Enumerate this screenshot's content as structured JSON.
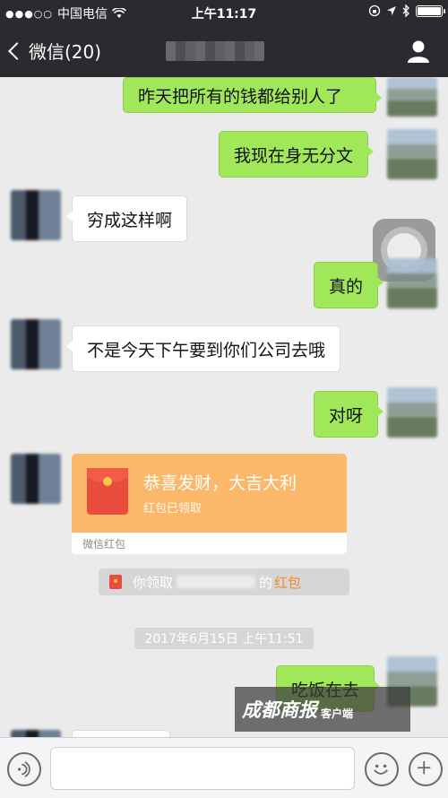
{
  "status_bar": {
    "signal": "●●●○○",
    "carrier": "中国电信",
    "time": "上午11:17"
  },
  "nav": {
    "back_label": "微信(20)"
  },
  "messages": {
    "m1": "昨天把所有的钱都给别人了",
    "m2": "我现在身无分文",
    "m3": "穷成这样啊",
    "m4": "真的",
    "m5": "不是今天下午要到你们公司去哦",
    "m6": "对呀",
    "m7": "吃饭在去"
  },
  "red_packet": {
    "title": "恭喜发财，大吉大利",
    "status": "红包已领取",
    "footer": "微信红包"
  },
  "system_notice": {
    "prefix": "你领取",
    "suffix": "的",
    "link": "红包"
  },
  "timestamp": "2017年6月15日 上午11:51",
  "watermark": {
    "main": "成都商报",
    "sub": "客户端"
  },
  "colors": {
    "bubble_self": "#a0e75a",
    "bubble_other": "#ffffff",
    "nav_bg": "#2b2b2f",
    "red_packet": "#fbb86a",
    "link": "#f08c2b"
  },
  "icons": {
    "back": "chevron-left-icon",
    "profile": "person-icon",
    "voice": "voice-icon",
    "emoji": "smiley-icon",
    "more": "plus-icon"
  }
}
